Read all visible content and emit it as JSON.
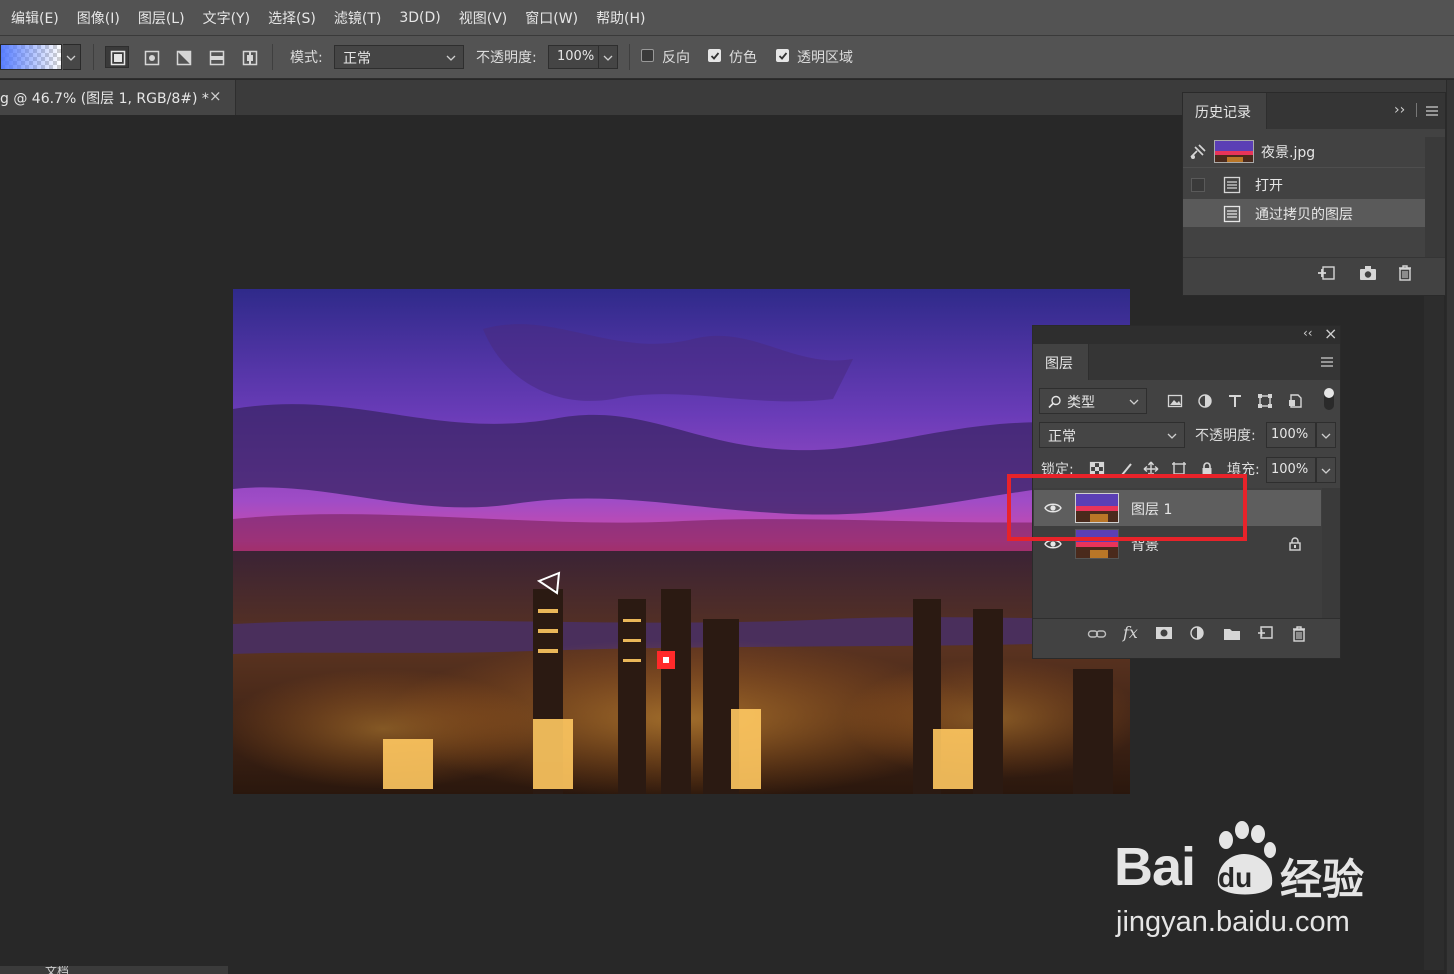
{
  "menubar": {
    "items": [
      "编辑(E)",
      "图像(I)",
      "图层(L)",
      "文字(Y)",
      "选择(S)",
      "滤镜(T)",
      "3D(D)",
      "视图(V)",
      "窗口(W)",
      "帮助(H)"
    ]
  },
  "options": {
    "mode_label": "模式:",
    "mode_value": "正常",
    "opacity_label": "不透明度:",
    "opacity_value": "100%",
    "reverse_label": "反向",
    "reverse_checked": false,
    "dither_label": "仿色",
    "dither_checked": true,
    "transparency_label": "透明区域",
    "transparency_checked": true
  },
  "document": {
    "tab_title": "g @ 46.7% (图层 1, RGB/8#) *",
    "close_glyph": "×"
  },
  "history": {
    "tab_label": "历史记录",
    "expand_glyph": "››",
    "snapshot": "夜景.jpg",
    "steps": [
      {
        "label": "打开",
        "active": false
      },
      {
        "label": "通过拷贝的图层",
        "active": true
      }
    ]
  },
  "layers": {
    "tab_label": "图层",
    "collapse_glyph": "‹‹",
    "close_glyph": "×",
    "filter_value": "类型",
    "blend_mode": "正常",
    "opacity_label": "不透明度:",
    "opacity_value": "100%",
    "lock_label": "锁定:",
    "fill_label": "填充:",
    "fill_value": "100%",
    "fx_label": "fx",
    "items": [
      {
        "name": "图层 1",
        "visible": true,
        "selected": true,
        "locked": false
      },
      {
        "name": "背景",
        "visible": true,
        "selected": false,
        "locked": true
      }
    ]
  },
  "watermark": {
    "brand_left": "Bai",
    "brand_paw": "du",
    "brand_right": "经验",
    "url": "jingyan.baidu.com"
  },
  "status": {
    "text": "文档"
  },
  "colors": {
    "menubar_bg": "#535353",
    "panel_bg": "#424242",
    "canvas_bg": "#282828",
    "highlight_box": "#e8232a"
  }
}
